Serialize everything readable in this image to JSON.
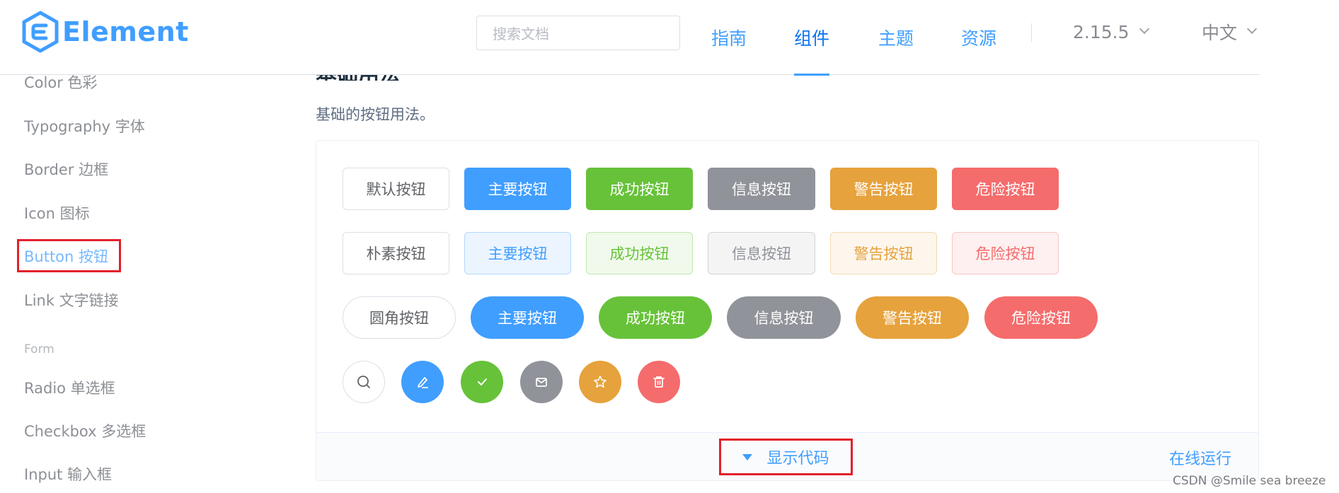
{
  "header": {
    "logo_text": "Element",
    "search_placeholder": "搜索文档",
    "nav": [
      {
        "label": "指南"
      },
      {
        "label": "组件"
      },
      {
        "label": "主题"
      },
      {
        "label": "资源"
      }
    ],
    "version": "2.15.5",
    "language": "中文"
  },
  "sidebar": {
    "items": [
      {
        "label": "Color 色彩"
      },
      {
        "label": "Typography 字体"
      },
      {
        "label": "Border 边框"
      },
      {
        "label": "Icon 图标"
      },
      {
        "label": "Button 按钮"
      },
      {
        "label": "Link 文字链接"
      }
    ],
    "group_form": "Form",
    "form_items": [
      {
        "label": "Radio 单选框"
      },
      {
        "label": "Checkbox 多选框"
      },
      {
        "label": "Input 输入框"
      }
    ]
  },
  "content": {
    "section_title": "基础用法",
    "description": "基础的按钮用法。",
    "default_row": [
      "默认按钮",
      "主要按钮",
      "成功按钮",
      "信息按钮",
      "警告按钮",
      "危险按钮"
    ],
    "plain_row": [
      "朴素按钮",
      "主要按钮",
      "成功按钮",
      "信息按钮",
      "警告按钮",
      "危险按钮"
    ],
    "round_row": [
      "圆角按钮",
      "主要按钮",
      "成功按钮",
      "信息按钮",
      "警告按钮",
      "危险按钮"
    ],
    "circle_icons": [
      "search-icon",
      "edit-icon",
      "check-icon",
      "message-icon",
      "star-icon",
      "delete-icon"
    ],
    "show_code": "显示代码",
    "run_online": "在线运行"
  },
  "colors": {
    "primary": "#409eff",
    "success": "#67c23a",
    "info": "#909399",
    "warning": "#e6a23c",
    "danger": "#f56c6c",
    "highlight_box": "#e3202a"
  },
  "watermark": "CSDN @Smile sea breeze"
}
